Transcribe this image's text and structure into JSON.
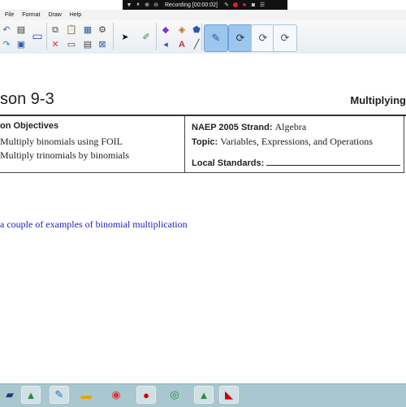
{
  "recording_bar": {
    "label": "Recording [00:00:02]",
    "icons": [
      "dropdown-arrow-icon",
      "pause-icon",
      "zoom-icon",
      "zoom-out-icon",
      "pen-icon",
      "record-icon",
      "stop-icon",
      "camera-icon",
      "menu-icon"
    ]
  },
  "menu": {
    "items": [
      "File",
      "Format",
      "Draw",
      "Help"
    ]
  },
  "document": {
    "title": "son 9-3",
    "topic": "Multiplying",
    "objectives_heading": "on Objectives",
    "objectives": [
      "Multiply binomials using FOIL",
      "Multiply trinomials by binomials"
    ],
    "naep_label": "NAEP 2005 Strand:",
    "naep_value": "Algebra",
    "topic_label": "Topic:",
    "topic_value": "Variables, Expressions, and Operations",
    "local_label": "Local Standards:",
    "annotation": "a couple of examples of binomial multiplication"
  },
  "colors": {
    "annotation": "#2020c8",
    "taskbar": "#a9c7cf",
    "active_tool": "#9cc6ee"
  }
}
